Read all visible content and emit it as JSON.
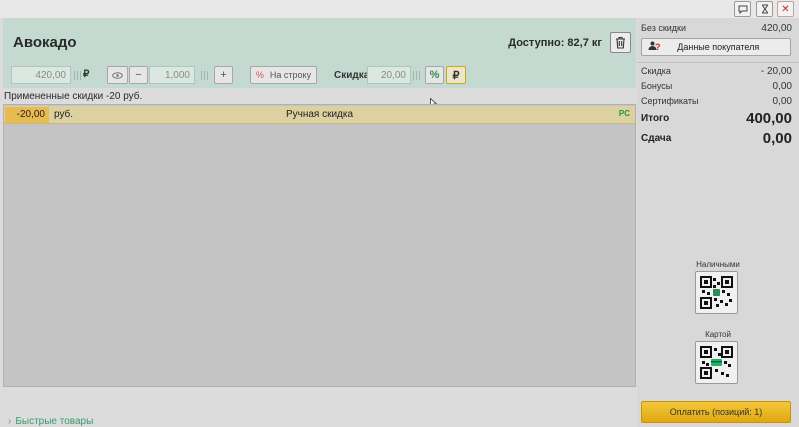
{
  "window_controls": {
    "chat_icon": "chat-icon",
    "hourglass_icon": "hourglass-icon",
    "close_symbol": "✕"
  },
  "product": {
    "title": "Авокадо",
    "available": "Доступно: 82,7 кг",
    "price": "420,00",
    "price_currency": "₽",
    "quantity": "1,000",
    "per_line_label": "На строку",
    "discount_label": "Скидка",
    "discount_value": "20,00",
    "percent_symbol": "%",
    "rub_symbol": "₽",
    "minus": "−",
    "plus": "+",
    "percent_prefix": "%"
  },
  "applied_discounts_text": "Примененные скидки -20 руб.",
  "discount_rows": [
    {
      "amount": "-20,00",
      "currency": "руб.",
      "name": "Ручная скидка",
      "badge": "PC"
    }
  ],
  "quick_products": "Быстрые товары",
  "summary": {
    "no_discount_label": "Без скидки",
    "no_discount_value": "420,00",
    "buyer_button": "Данные покупателя",
    "discount_label": "Скидка",
    "discount_value": "- 20,00",
    "bonuses_label": "Бонусы",
    "bonuses_value": "0,00",
    "certificates_label": "Сертификаты",
    "certificates_value": "0,00",
    "total_label": "Итого",
    "total_value": "400,00",
    "change_label": "Сдача",
    "change_value": "0,00",
    "cash_label": "Наличными",
    "card_label": "Картой",
    "pay_button": "Оплатить (позиций: 1)"
  },
  "colors": {
    "product_panel": "#c4dad0",
    "discount_row": "#ddd0a1",
    "discount_amount": "#e7ba52",
    "pay_button": "#f0b820",
    "pc_badge": "#1a9e2e",
    "cash_qr_accent": "#2e8b57",
    "card_qr_accent": "#1fb36a"
  }
}
